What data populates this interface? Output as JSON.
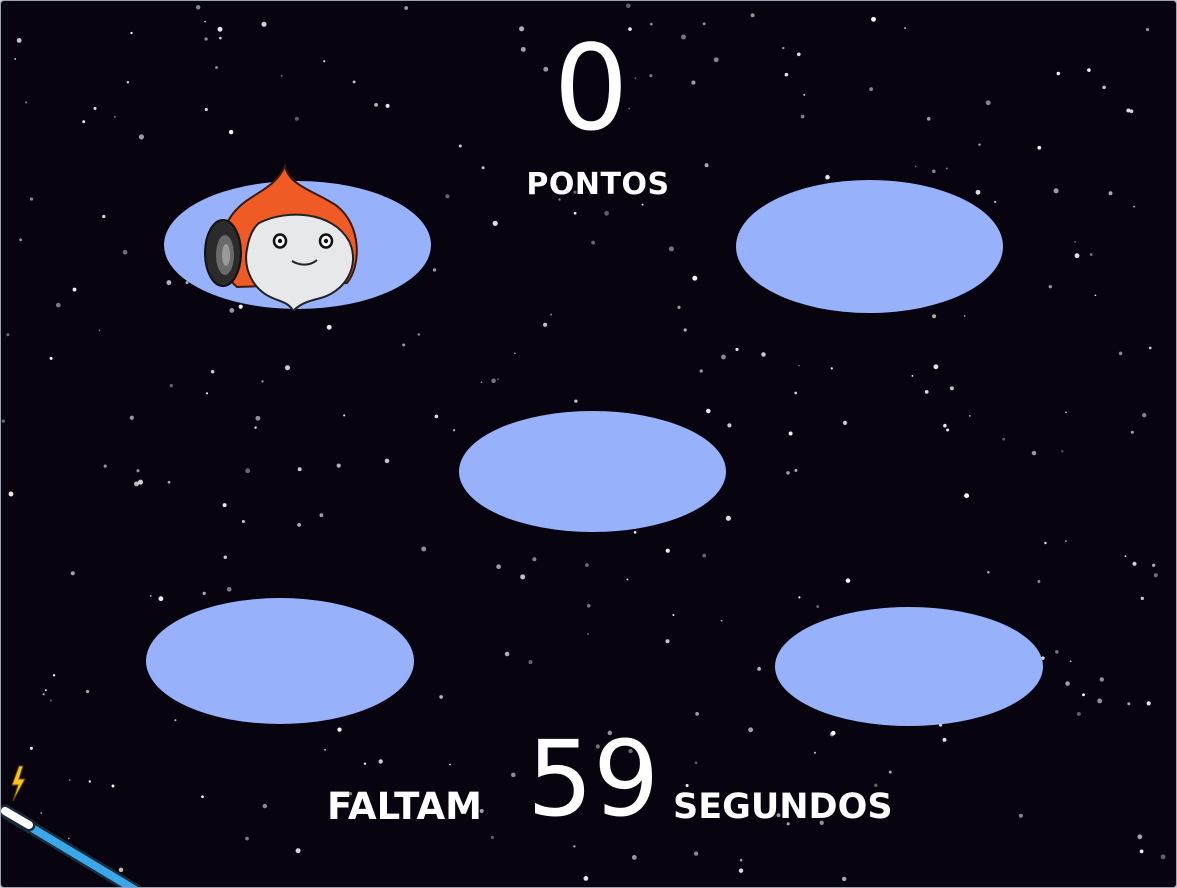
{
  "score": {
    "value": "0",
    "label": "PONTOS"
  },
  "timer": {
    "prefix": "FALTAM",
    "value": "59",
    "suffix": "SEGUNDOS"
  },
  "holes": [
    {
      "name": "hole-top-left",
      "occupied": true
    },
    {
      "name": "hole-top-right",
      "occupied": false
    },
    {
      "name": "hole-center",
      "occupied": false
    },
    {
      "name": "hole-bottom-left",
      "occupied": false
    },
    {
      "name": "hole-bottom-right",
      "occupied": false
    }
  ],
  "character": {
    "icon": "orange-hooded-ghost-icon"
  },
  "cursor": {
    "icon": "magic-wand-icon"
  },
  "colors": {
    "background": "#08040f",
    "hole": "#97b2fb",
    "character_hood": "#f05a24",
    "wand_shaft": "#3aa8e8",
    "text": "#ffffff"
  }
}
